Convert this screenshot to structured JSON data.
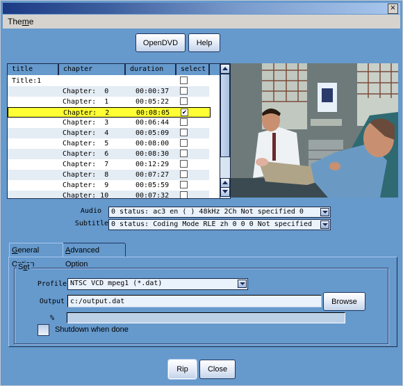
{
  "window": {
    "title": "",
    "close_glyph": "×"
  },
  "menu": {
    "items": [
      {
        "label_pre": "The",
        "label_ul": "m",
        "label_post": "e"
      }
    ]
  },
  "toolbar": {
    "open_dvd_label": "OpenDVD",
    "help_label": "Help"
  },
  "chapter_list": {
    "columns": [
      "title",
      "chapter",
      "duration",
      "select"
    ],
    "title_row": {
      "title": "Title:1",
      "selected": false
    },
    "rows": [
      {
        "chapter": "Chapter:  0",
        "duration": "00:00:37",
        "selected": false
      },
      {
        "chapter": "Chapter:  1",
        "duration": "00:05:22",
        "selected": false
      },
      {
        "chapter": "Chapter:  2",
        "duration": "00:08:05",
        "selected": true,
        "highlighted": true
      },
      {
        "chapter": "Chapter:  3",
        "duration": "00:06:44",
        "selected": false
      },
      {
        "chapter": "Chapter:  4",
        "duration": "00:05:09",
        "selected": false
      },
      {
        "chapter": "Chapter:  5",
        "duration": "00:08:00",
        "selected": false
      },
      {
        "chapter": "Chapter:  6",
        "duration": "00:08:30",
        "selected": false
      },
      {
        "chapter": "Chapter:  7",
        "duration": "00:12:29",
        "selected": false
      },
      {
        "chapter": "Chapter:  8",
        "duration": "00:07:27",
        "selected": false
      },
      {
        "chapter": "Chapter:  9",
        "duration": "00:05:59",
        "selected": false
      },
      {
        "chapter": "Chapter: 10",
        "duration": "00:07:32",
        "selected": false
      }
    ]
  },
  "preview": {
    "description": "video frame: doctor in white coat talking with patient in exam chair"
  },
  "streams": {
    "audio_label": "Audio",
    "audio_value": "0 status: ac3 en ( ) 48kHz 2Ch Not specified 0",
    "subtitle_label": "Subtitle",
    "subtitle_value": "0 status: Coding Mode RLE zh 0 0 0 Not specified"
  },
  "tabs": [
    {
      "ul": "G",
      "rest": "eneral Option",
      "active": true
    },
    {
      "ul": "A",
      "rest": "dvanced Option",
      "active": false
    }
  ],
  "settings": {
    "group_title_pre": "S",
    "group_title_ul": "e",
    "group_title_post": "t",
    "profile_label": "Profile",
    "profile_value": "NTSC VCD mpeg1 (*.dat)",
    "output_label": "Output",
    "output_value": "c:/output.dat",
    "browse_label": "Browse",
    "percent_label": "%",
    "progress_percent": 0,
    "shutdown_label": "Shutdown when done",
    "shutdown_checked": false
  },
  "footer": {
    "rip_label": "Rip",
    "close_label": "Close"
  },
  "colors": {
    "background": "#6699cc",
    "highlight_row": "#ffff33",
    "menubar": "#d6d3ce"
  }
}
